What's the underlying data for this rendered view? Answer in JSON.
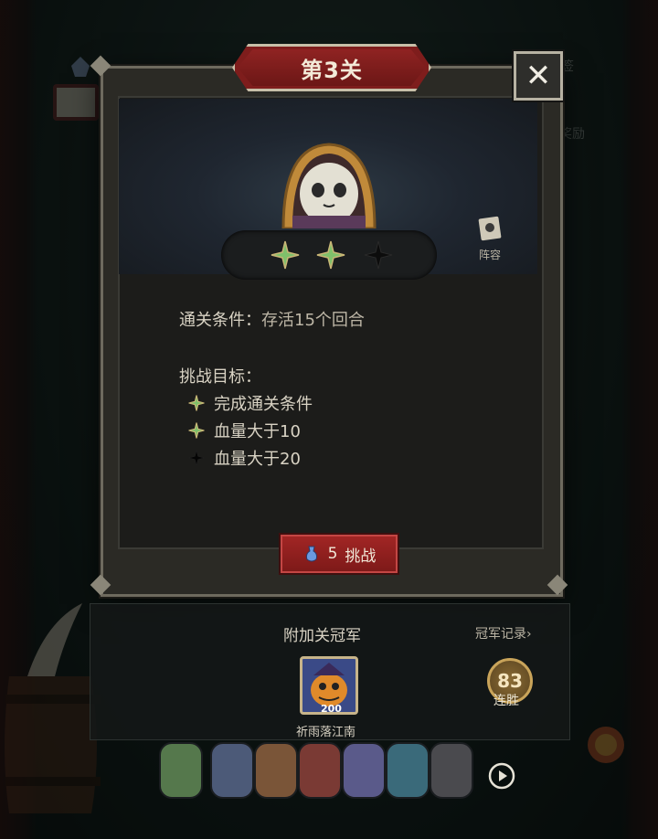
{
  "modal": {
    "title": "第3关",
    "close_icon": "close-icon",
    "lineup_label": "阵容",
    "stars": [
      {
        "earned": true
      },
      {
        "earned": true
      },
      {
        "earned": false
      }
    ],
    "condition_label": "通关条件：",
    "condition_value": "存活15个回合",
    "goals_title": "挑战目标：",
    "goals": [
      {
        "text": "完成通关条件",
        "earned": true
      },
      {
        "text": "血量大于10",
        "earned": true
      },
      {
        "text": "血量大于20",
        "earned": false
      }
    ],
    "challenge_cost": "5",
    "challenge_label": "挑战"
  },
  "champion": {
    "title": "附加关冠军",
    "record_link": "冠军记录",
    "name": "祈雨落江南",
    "level": "200",
    "streak_count": "83",
    "streak_label": "连胜"
  },
  "background": {
    "top_right_text": "奖励",
    "top_right_text2": "签"
  },
  "colors": {
    "accent_red": "#7e1d1c",
    "star_green": "#7fc06a",
    "star_dark": "#111111",
    "panel_bg": "#1c1c1a"
  }
}
